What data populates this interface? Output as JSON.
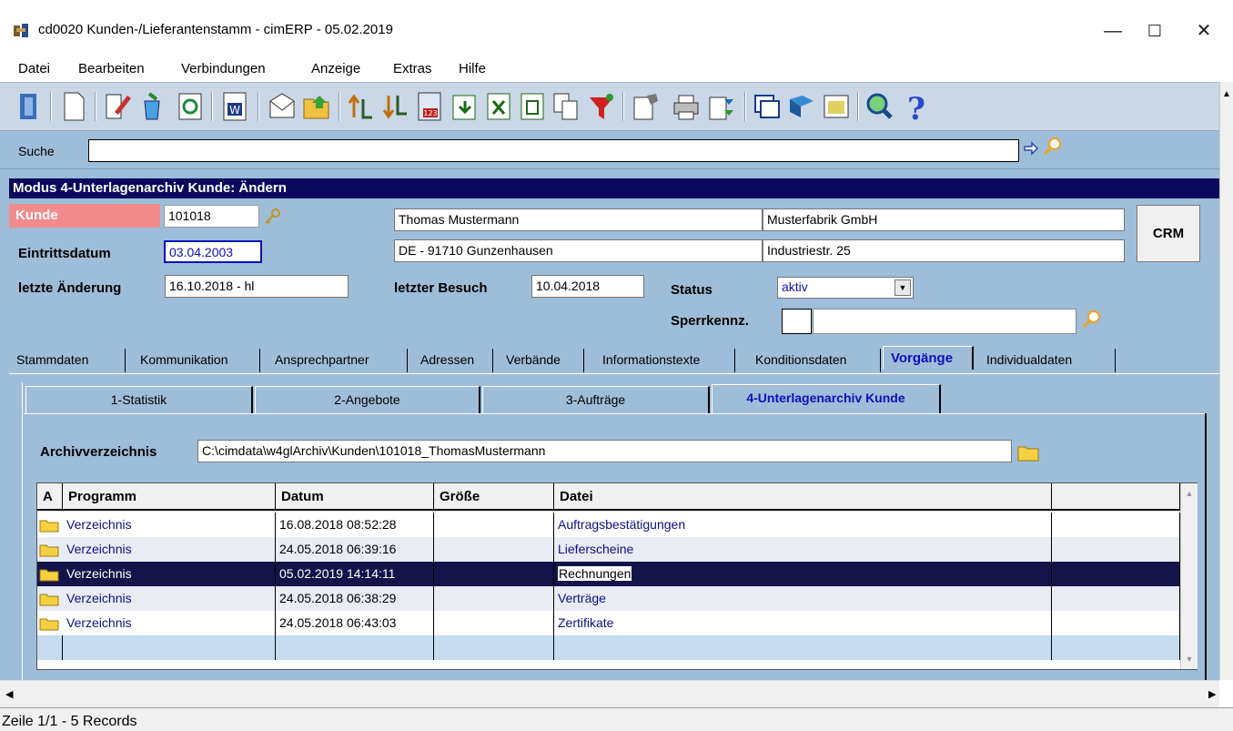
{
  "window": {
    "title": "cd0020 Kunden-/Lieferantenstamm - cimERP - 05.02.2019",
    "minimize": "—",
    "maximize": "☐",
    "close": "✕"
  },
  "menu": [
    "Datei",
    "Bearbeiten",
    "Verbindungen",
    "Anzeige",
    "Extras",
    "Hilfe"
  ],
  "search": {
    "label": "Suche",
    "value": ""
  },
  "mode": "Modus 4-Unterlagenarchiv Kunde: Ändern",
  "customer": {
    "kunde_label": "Kunde",
    "kunde_nr": "101018",
    "name": "Thomas Mustermann",
    "company": "Musterfabrik GmbH",
    "city": "DE - 91710 Gunzenhausen",
    "street": "Industriestr. 25",
    "eintritt_label": "Eintrittsdatum",
    "eintritt": "03.04.2003",
    "aenderung_label": "letzte Änderung",
    "aenderung": "16.10.2018 - hl",
    "besuch_label": "letzter Besuch",
    "besuch": "10.04.2018",
    "status_label": "Status",
    "status": "aktiv",
    "sperr_label": "Sperrkennz.",
    "sperr_code": "",
    "sperr_text": "",
    "crm": "CRM"
  },
  "tabs": [
    "Stammdaten",
    "Kommunikation",
    "Ansprechpartner",
    "Adressen",
    "Verbände",
    "Informationstexte",
    "Konditionsdaten",
    "Vorgänge",
    "Individualdaten"
  ],
  "subtabs": [
    "1-Statistik",
    "2-Angebote",
    "3-Aufträge",
    "4-Unterlagenarchiv Kunde"
  ],
  "archive": {
    "label": "Archivverzeichnis",
    "path": "C:\\cimdata\\w4glArchiv\\Kunden\\101018_ThomasMustermann"
  },
  "grid": {
    "headers": [
      "A",
      "Programm",
      "Datum",
      "Größe",
      "Datei",
      ""
    ],
    "rows": [
      {
        "programm": "Verzeichnis",
        "datum": "16.08.2018 08:52:28",
        "groesse": "",
        "datei": "Auftragsbestätigungen"
      },
      {
        "programm": "Verzeichnis",
        "datum": "24.05.2018 06:39:16",
        "groesse": "",
        "datei": "Lieferscheine"
      },
      {
        "programm": "Verzeichnis",
        "datum": "05.02.2019 14:14:11",
        "groesse": "",
        "datei": "Rechnungen"
      },
      {
        "programm": "Verzeichnis",
        "datum": "24.05.2018 06:38:29",
        "groesse": "",
        "datei": "Verträge"
      },
      {
        "programm": "Verzeichnis",
        "datum": "24.05.2018 06:43:03",
        "groesse": "",
        "datei": "Zertifikate"
      }
    ]
  },
  "status_bar": "Zeile 1/1 - 5 Records",
  "colors": {
    "panel": "#9ebdd9",
    "mode_bar": "#0a0a5e",
    "kunde_label": "#f28b8b",
    "selected_row": "#14144a",
    "active_tab": "#0f0fb8"
  }
}
